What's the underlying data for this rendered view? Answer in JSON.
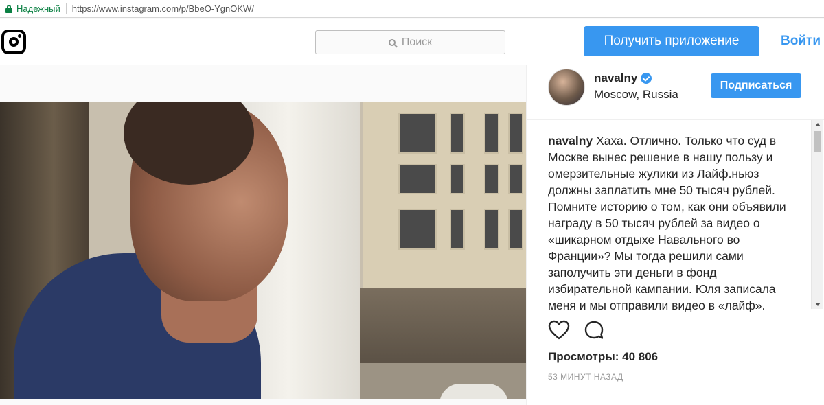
{
  "browser": {
    "secure_label": "Надежный",
    "url": "https://www.instagram.com/p/BbeO-YgnOKW/"
  },
  "nav": {
    "search_placeholder": "Поиск",
    "get_app_label": "Получить приложение",
    "login_label": "Войти"
  },
  "post": {
    "username": "navalny",
    "location": "Moscow, Russia",
    "follow_label": "Подписаться",
    "caption_username": "navalny",
    "caption_text": "Хаха. Отлично. Только что суд в Москве вынес решение в нашу пользу и омерзительные жулики из Лайф.ньюз должны заплатить мне 50 тысяч рублей. Помните историю о том, как они объявили награду в 50 тысяч рублей за видео о «шикарном отдыхе Навального во Франции»? Мы тогда решили сами заполучить эти деньги в фонд избирательной кампании. Юля записала меня и мы отправили видео в «лайф».",
    "views_label": "Просмотры: 40 806",
    "time_ago": "53 МИНУТ НАЗАД"
  },
  "colors": {
    "accent": "#3897f0",
    "secure_green": "#0b8043"
  },
  "icons": {
    "lock": "lock-icon",
    "logo": "instagram-logo-icon",
    "search": "search-icon",
    "verified": "verified-badge-icon",
    "like": "heart-icon",
    "comment": "comment-icon"
  }
}
